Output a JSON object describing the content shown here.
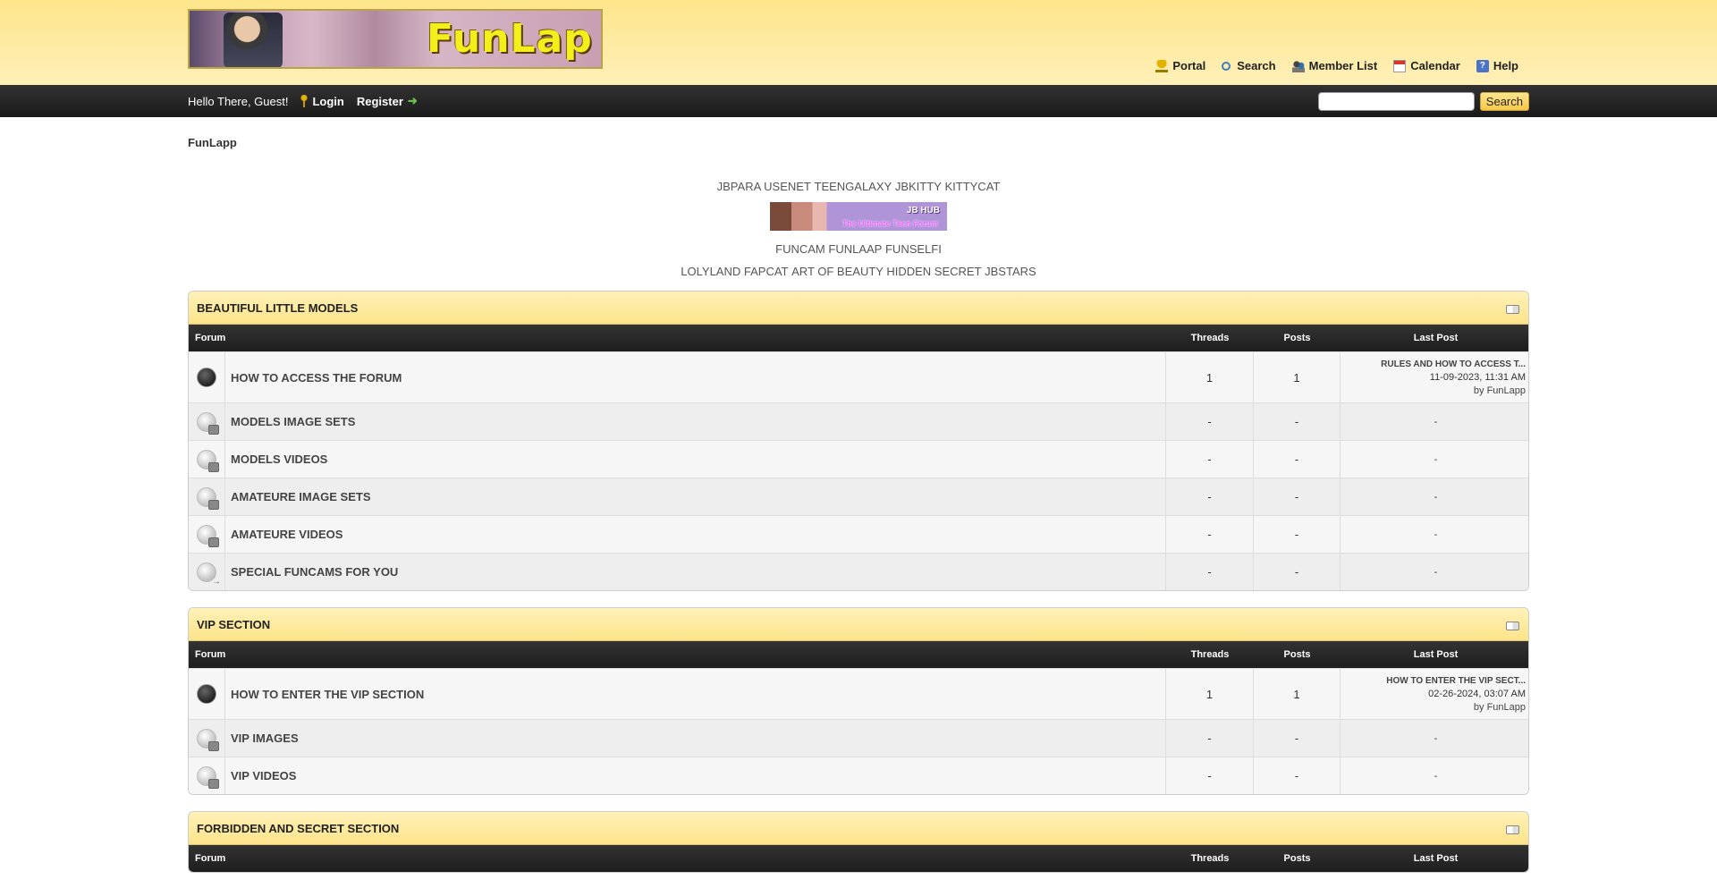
{
  "header": {
    "logo_text": "FunLap",
    "nav": [
      {
        "label": "Portal",
        "icon": "portal-icon"
      },
      {
        "label": "Search",
        "icon": "search-icon"
      },
      {
        "label": "Member List",
        "icon": "member-list-icon"
      },
      {
        "label": "Calendar",
        "icon": "calendar-icon"
      },
      {
        "label": "Help",
        "icon": "help-icon"
      }
    ]
  },
  "userbar": {
    "greeting": "Hello There, Guest!",
    "login_label": "Login",
    "register_label": "Register",
    "search_placeholder": "",
    "search_button": "Search"
  },
  "breadcrumb": "FunLapp",
  "banners": {
    "row1": [
      "JBPARA USENET",
      "TEENGALAXY",
      "JBKITTY",
      "KITTYCAT"
    ],
    "jbhub_title": "JB HUB",
    "jbhub_sub": "The Ultimate Teen Forum",
    "row2": [
      "FUNCAM",
      "FUNLAAP",
      "FUNSELFI"
    ],
    "row3": [
      "LOLYLAND",
      "FAPCAT",
      "ART OF BEAUTY HIDDEN SECRET",
      "JBSTARS"
    ]
  },
  "columns": {
    "forum": "Forum",
    "threads": "Threads",
    "posts": "Posts",
    "last_post": "Last Post"
  },
  "categories": [
    {
      "title": "BEAUTIFUL LITTLE MODELS",
      "forums": [
        {
          "name": "HOW TO ACCESS THE FORUM",
          "threads": "1",
          "posts": "1",
          "last_title": "RULES AND HOW TO ACCESS T...",
          "last_date": "11-09-2023, 11:31 AM",
          "last_by": "by",
          "last_user": "FunLapp"
        },
        {
          "name": "MODELS IMAGE SETS",
          "threads": "-",
          "posts": "-",
          "last": "-"
        },
        {
          "name": "MODELS VIDEOS",
          "threads": "-",
          "posts": "-",
          "last": "-"
        },
        {
          "name": "AMATEURE IMAGE SETS",
          "threads": "-",
          "posts": "-",
          "last": "-"
        },
        {
          "name": "AMATEURE VIDEOS",
          "threads": "-",
          "posts": "-",
          "last": "-"
        },
        {
          "name": "SPECIAL FUNCAMS FOR YOU",
          "threads": "-",
          "posts": "-",
          "last": "-"
        }
      ]
    },
    {
      "title": "VIP SECTION",
      "forums": [
        {
          "name": "HOW TO ENTER THE VIP SECTION",
          "threads": "1",
          "posts": "1",
          "last_title": "HOW TO ENTER THE VIP SECT...",
          "last_date": "02-26-2024, 03:07 AM",
          "last_by": "by",
          "last_user": "FunLapp"
        },
        {
          "name": "VIP IMAGES",
          "threads": "-",
          "posts": "-",
          "last": "-"
        },
        {
          "name": "VIP VIDEOS",
          "threads": "-",
          "posts": "-",
          "last": "-"
        }
      ]
    },
    {
      "title": "FORBIDDEN AND SECRET SECTION",
      "forums": []
    }
  ]
}
